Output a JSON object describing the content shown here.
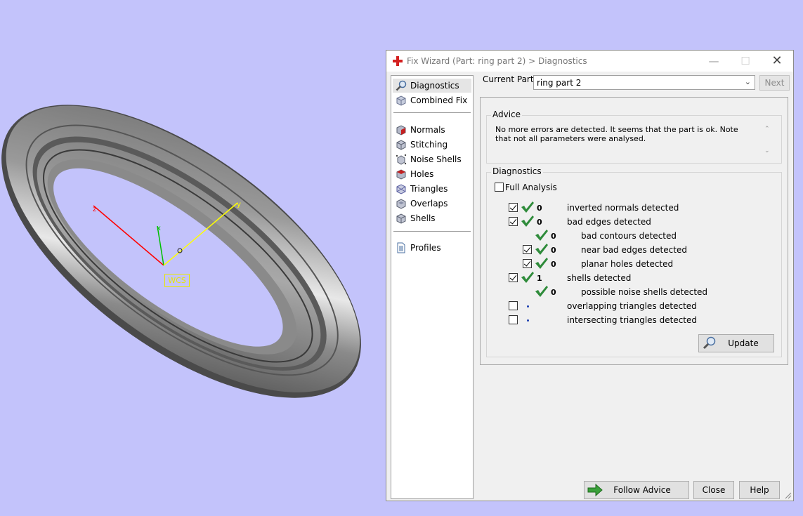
{
  "viewport": {
    "wcs_label": "WCS",
    "axis_labels": {
      "z": "z",
      "x": "x",
      "y": "y"
    }
  },
  "dialog": {
    "title": "Fix Wizard (Part: ring part 2) > Diagnostics",
    "nav": {
      "top_items": [
        {
          "label": "Diagnostics",
          "icon": "magnifier-icon",
          "selected": true
        },
        {
          "label": "Combined Fix",
          "icon": "cube-icon"
        }
      ],
      "fix_items": [
        {
          "label": "Normals",
          "icon": "normals-cube-icon"
        },
        {
          "label": "Stitching",
          "icon": "stitching-cube-icon"
        },
        {
          "label": "Noise Shells",
          "icon": "noise-shells-icon"
        },
        {
          "label": "Holes",
          "icon": "holes-cube-icon"
        },
        {
          "label": "Triangles",
          "icon": "triangles-icon"
        },
        {
          "label": "Overlaps",
          "icon": "overlaps-icon"
        },
        {
          "label": "Shells",
          "icon": "shells-icon"
        }
      ],
      "bottom_items": [
        {
          "label": "Profiles",
          "icon": "document-icon"
        }
      ]
    },
    "current_part_label": "Current Part:",
    "current_part_value": "ring part 2",
    "next_label": "Next",
    "advice": {
      "title": "Advice",
      "text": "No more errors are detected. It seems that the part is ok. Note that not all parameters were analysed."
    },
    "diagnostics": {
      "title": "Diagnostics",
      "full_analysis_label": "Full Analysis",
      "full_analysis_checked": false,
      "rows": [
        {
          "checkbox": true,
          "checked": true,
          "status": "ok",
          "count": "0",
          "label": "inverted normals detected",
          "indent": 0
        },
        {
          "checkbox": true,
          "checked": true,
          "status": "ok",
          "count": "0",
          "label": "bad edges detected",
          "indent": 0
        },
        {
          "checkbox": false,
          "checked": false,
          "status": "ok",
          "count": "0",
          "label": "bad contours detected",
          "indent": 1
        },
        {
          "checkbox": true,
          "checked": true,
          "status": "ok",
          "count": "0",
          "label": "near bad edges detected",
          "indent": 1
        },
        {
          "checkbox": true,
          "checked": true,
          "status": "ok",
          "count": "0",
          "label": "planar holes detected",
          "indent": 1
        },
        {
          "checkbox": true,
          "checked": true,
          "status": "ok",
          "count": "1",
          "label": "shells detected",
          "indent": 0
        },
        {
          "checkbox": false,
          "checked": false,
          "status": "ok",
          "count": "0",
          "label": "possible noise shells detected",
          "indent": 1
        },
        {
          "checkbox": true,
          "checked": false,
          "status": "pending",
          "count": "",
          "label": "overlapping triangles detected",
          "indent": 0
        },
        {
          "checkbox": true,
          "checked": false,
          "status": "pending",
          "count": "",
          "label": "intersecting triangles detected",
          "indent": 0
        }
      ]
    },
    "update_label": "Update",
    "follow_advice_label": "Follow Advice",
    "close_label": "Close",
    "help_label": "Help",
    "colors": {
      "check": "#2e8b3a",
      "background": "#c3c3fb",
      "dot": "#1c3fb0"
    }
  }
}
